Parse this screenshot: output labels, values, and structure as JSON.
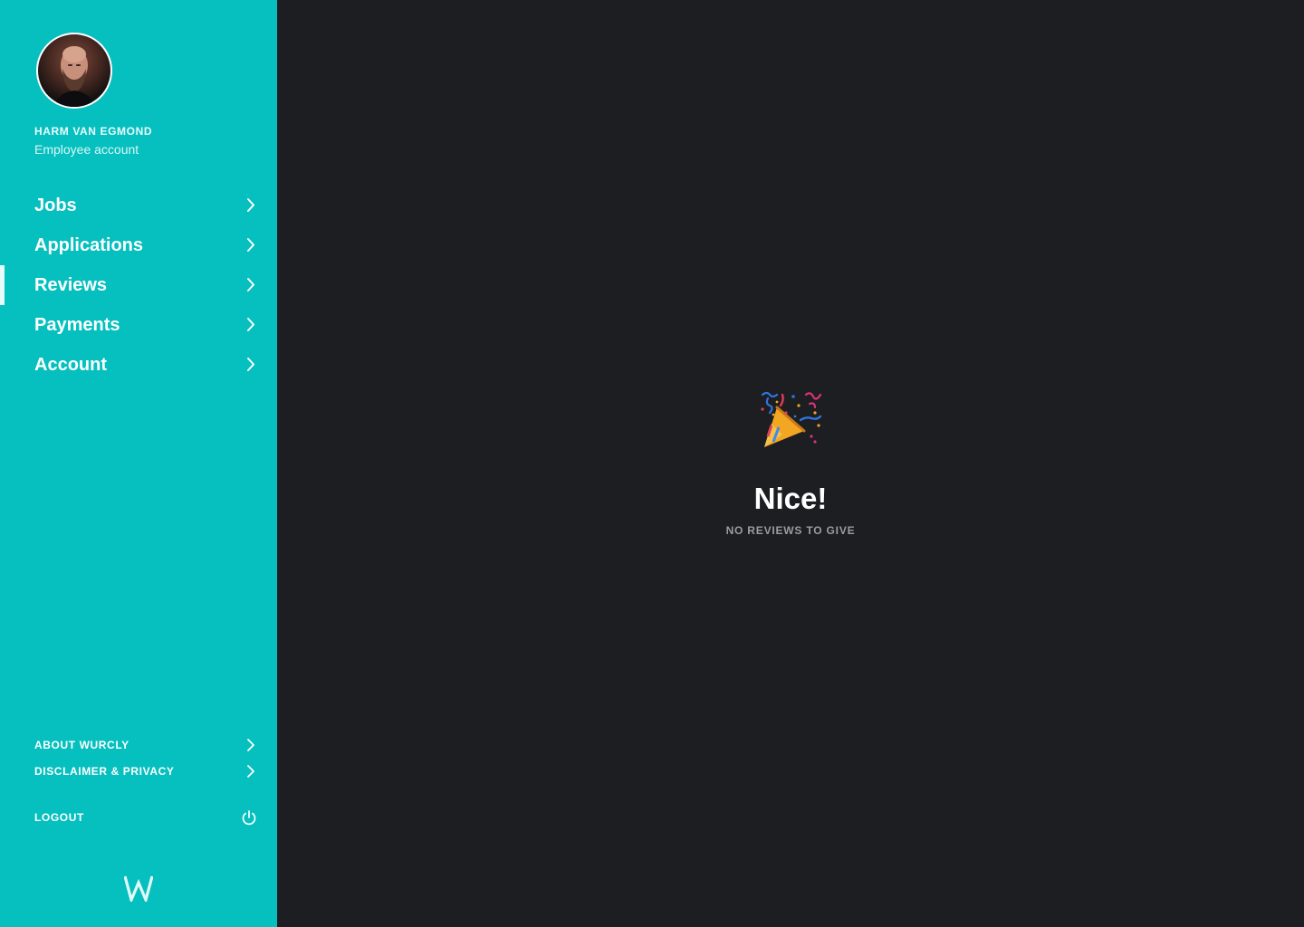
{
  "user": {
    "name": "HARM VAN EGMOND",
    "role": "Employee account"
  },
  "nav": {
    "items": [
      {
        "label": "Jobs",
        "active": false
      },
      {
        "label": "Applications",
        "active": false
      },
      {
        "label": "Reviews",
        "active": true
      },
      {
        "label": "Payments",
        "active": false
      },
      {
        "label": "Account",
        "active": false
      }
    ]
  },
  "footer": {
    "about_label": "ABOUT WURCLY",
    "disclaimer_label": "DISCLAIMER & PRIVACY",
    "logout_label": "LOGOUT"
  },
  "empty_state": {
    "icon": "party-popper-icon",
    "title": "Nice!",
    "subtitle": "NO REVIEWS TO GIVE"
  },
  "colors": {
    "sidebar": "#06bfbf",
    "main_background": "#1d1e21",
    "text_primary": "#ffffff",
    "text_muted": "#9a9ca1"
  }
}
